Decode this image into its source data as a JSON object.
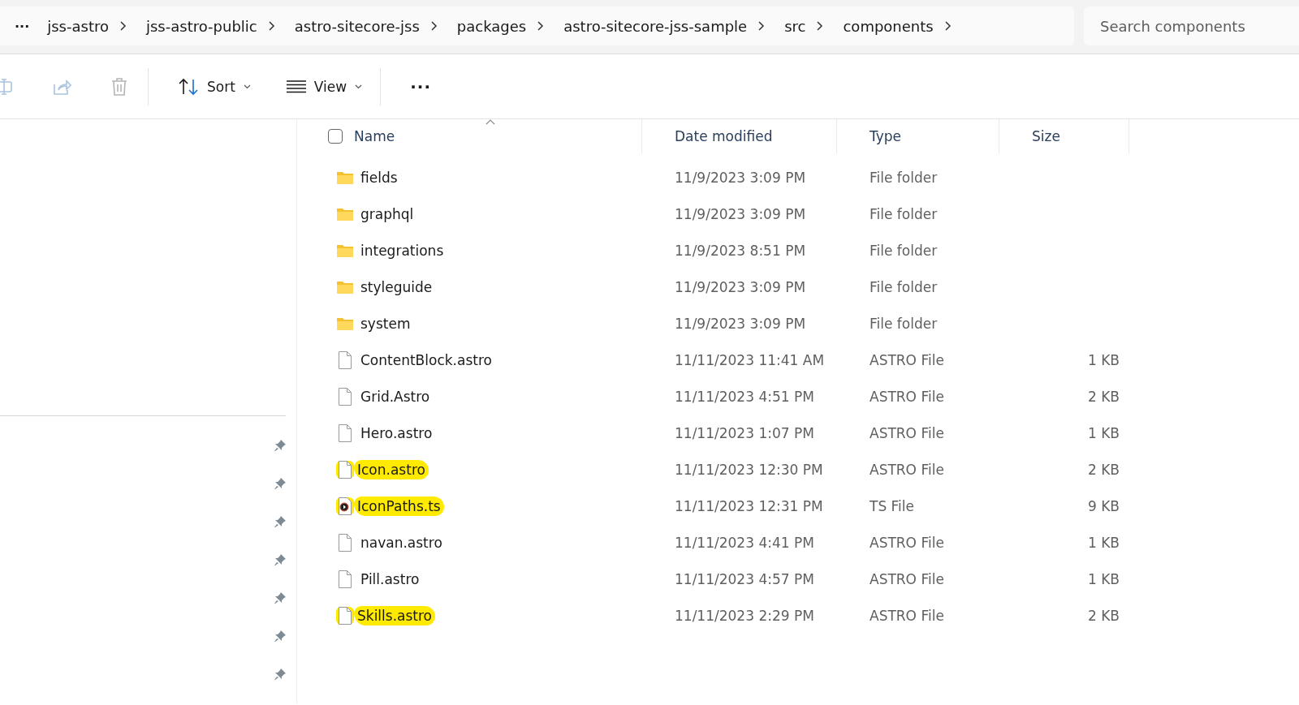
{
  "breadcrumb": {
    "overflow": "···",
    "items": [
      "jss-astro",
      "jss-astro-public",
      "astro-sitecore-jss",
      "packages",
      "astro-sitecore-jss-sample",
      "src",
      "components"
    ]
  },
  "search": {
    "placeholder": "Search components"
  },
  "toolbar": {
    "sort": "Sort",
    "view": "View",
    "more": "···"
  },
  "columns": [
    {
      "label": "Name",
      "sorted": true
    },
    {
      "label": "Date modified",
      "sorted": false
    },
    {
      "label": "Type",
      "sorted": false
    },
    {
      "label": "Size",
      "sorted": false
    }
  ],
  "rows": [
    {
      "kind": "folder",
      "name": "fields",
      "date": "11/9/2023 3:09 PM",
      "type": "File folder",
      "highlighted": false
    },
    {
      "kind": "folder",
      "name": "graphql",
      "date": "11/9/2023 3:09 PM",
      "type": "File folder",
      "highlighted": false
    },
    {
      "kind": "folder",
      "name": "integrations",
      "date": "11/9/2023 8:51 PM",
      "type": "File folder",
      "highlighted": false
    },
    {
      "kind": "folder",
      "name": "styleguide",
      "date": "11/9/2023 3:09 PM",
      "type": "File folder",
      "highlighted": false
    },
    {
      "kind": "folder",
      "name": "system",
      "date": "11/9/2023 3:09 PM",
      "type": "File folder",
      "highlighted": false
    },
    {
      "kind": "file",
      "name": "ContentBlock.astro",
      "date": "11/11/2023 11:41 AM",
      "type": "ASTRO File",
      "size": "1 KB",
      "highlighted": false
    },
    {
      "kind": "file",
      "name": "Grid.Astro",
      "date": "11/11/2023 4:51 PM",
      "type": "ASTRO File",
      "size": "2 KB",
      "highlighted": false
    },
    {
      "kind": "file",
      "name": "Hero.astro",
      "date": "11/11/2023 1:07 PM",
      "type": "ASTRO File",
      "size": "1 KB",
      "highlighted": false
    },
    {
      "kind": "file",
      "name": "Icon.astro",
      "date": "11/11/2023 12:30 PM",
      "type": "ASTRO File",
      "size": "2 KB",
      "highlighted": true
    },
    {
      "kind": "script",
      "name": "IconPaths.ts",
      "date": "11/11/2023 12:31 PM",
      "type": "TS File",
      "size": "9 KB",
      "highlighted": true
    },
    {
      "kind": "file",
      "name": "navan.astro",
      "date": "11/11/2023 4:41 PM",
      "type": "ASTRO File",
      "size": "1 KB",
      "highlighted": false
    },
    {
      "kind": "file",
      "name": "Pill.astro",
      "date": "11/11/2023 4:57 PM",
      "type": "ASTRO File",
      "size": "1 KB",
      "highlighted": false
    },
    {
      "kind": "file",
      "name": "Skills.astro",
      "date": "11/11/2023 2:29 PM",
      "type": "ASTRO File",
      "size": "2 KB",
      "highlighted": true
    }
  ],
  "list": {
    "all_selected": false
  },
  "sidebar": {
    "pins": [
      true,
      true,
      true,
      true,
      true,
      true,
      true
    ]
  }
}
